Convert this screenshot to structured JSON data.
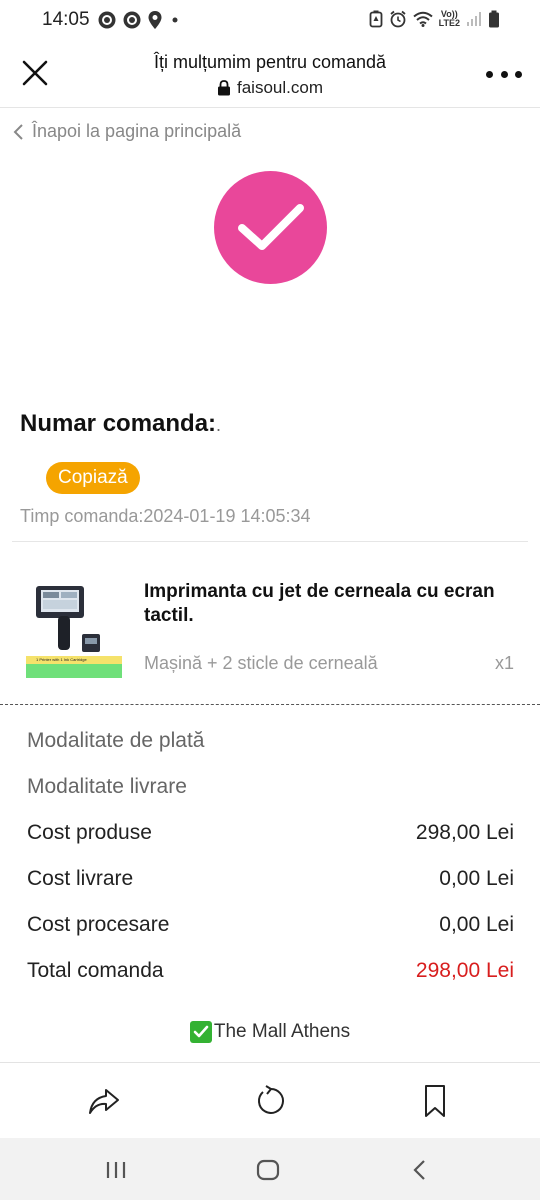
{
  "status_bar": {
    "time": "14:05",
    "lte_line1": "Vo))",
    "lte_line2": "LTE2"
  },
  "header": {
    "title": "Îți mulțumim pentru comandă",
    "url": "faisoul.com"
  },
  "back_link": "Înapoi la pagina principală",
  "order": {
    "number_label": "Numar comanda:",
    "number_value": ".",
    "copy_label": "Copiază",
    "time_text": "Timp comanda:2024-01-19 14:05:34"
  },
  "product": {
    "title": "Imprimanta cu jet de cerneala cu ecran tactil.",
    "variant": "Mașină + 2 sticle de cerneală",
    "quantity": "x1",
    "image_caption": "1 Printer with 1 Ink Cartridge"
  },
  "summary": {
    "payment_method_label": "Modalitate de plată",
    "delivery_method_label": "Modalitate livrare",
    "product_cost_label": "Cost produse",
    "product_cost_value": "298,00 Lei",
    "delivery_cost_label": "Cost livrare",
    "delivery_cost_value": "0,00 Lei",
    "processing_cost_label": "Cost procesare",
    "processing_cost_value": "0,00 Lei",
    "total_label": "Total comanda",
    "total_value": "298,00 Lei"
  },
  "mall_text": "The Mall Athens",
  "colors": {
    "success_pink": "#e9479a",
    "copy_orange": "#f5a400",
    "total_red": "#d81e1e",
    "check_green": "#34b233"
  },
  "icons": {
    "close": "close-icon",
    "more": "more-vertical-dots-icon",
    "lock": "lock-icon",
    "back": "chevron-left-icon",
    "success": "checkmark-icon",
    "share": "share-icon",
    "reload": "reload-icon",
    "bookmark": "bookmark-icon"
  }
}
